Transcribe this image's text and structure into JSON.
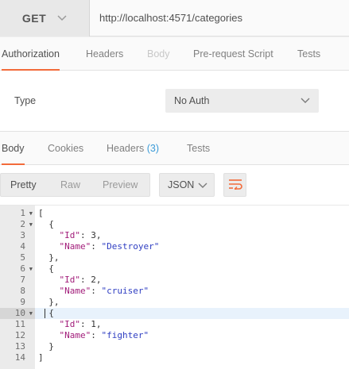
{
  "request": {
    "method": "GET",
    "url": "http://localhost:4571/categories"
  },
  "request_tabs": [
    {
      "label": "Authorization",
      "state": "active"
    },
    {
      "label": "Headers",
      "state": "normal"
    },
    {
      "label": "Body",
      "state": "disabled"
    },
    {
      "label": "Pre-request Script",
      "state": "normal"
    },
    {
      "label": "Tests",
      "state": "normal"
    }
  ],
  "auth": {
    "type_label": "Type",
    "type_value": "No Auth"
  },
  "response_tabs": [
    {
      "label": "Body",
      "state": "active"
    },
    {
      "label": "Cookies",
      "state": "normal"
    },
    {
      "label": "Headers",
      "count": "(3)",
      "state": "normal"
    },
    {
      "label": "Tests",
      "state": "normal"
    }
  ],
  "view_modes": [
    "Pretty",
    "Raw",
    "Preview"
  ],
  "active_view_mode": "Pretty",
  "format": "JSON",
  "icons": {
    "method_dropdown": "chevron-down-icon",
    "auth_dropdown": "chevron-down-icon",
    "format_dropdown": "chevron-down-icon",
    "wrap": "wrap-lines-icon",
    "fold": "fold-arrow-icon"
  },
  "colors": {
    "accent": "#f26b3a",
    "count": "#3b9bd8",
    "json_key": "#a21d7a",
    "json_string": "#2f3ec2",
    "highlight_line": "#e8f2fc"
  },
  "code": {
    "highlighted_line": "10",
    "lines": [
      {
        "n": "1",
        "fold": true,
        "text": "["
      },
      {
        "n": "2",
        "fold": true,
        "text": "  {"
      },
      {
        "n": "3",
        "fold": false,
        "text": "    \"Id\": 3,"
      },
      {
        "n": "4",
        "fold": false,
        "text": "    \"Name\": \"Destroyer\""
      },
      {
        "n": "5",
        "fold": false,
        "text": "  },"
      },
      {
        "n": "6",
        "fold": true,
        "text": "  {"
      },
      {
        "n": "7",
        "fold": false,
        "text": "    \"Id\": 2,"
      },
      {
        "n": "8",
        "fold": false,
        "text": "    \"Name\": \"cruiser\""
      },
      {
        "n": "9",
        "fold": false,
        "text": "  },"
      },
      {
        "n": "10",
        "fold": true,
        "text": "  {"
      },
      {
        "n": "11",
        "fold": false,
        "text": "    \"Id\": 1,"
      },
      {
        "n": "12",
        "fold": false,
        "text": "    \"Name\": \"fighter\""
      },
      {
        "n": "13",
        "fold": false,
        "text": "  }"
      },
      {
        "n": "14",
        "fold": false,
        "text": "]"
      }
    ]
  }
}
